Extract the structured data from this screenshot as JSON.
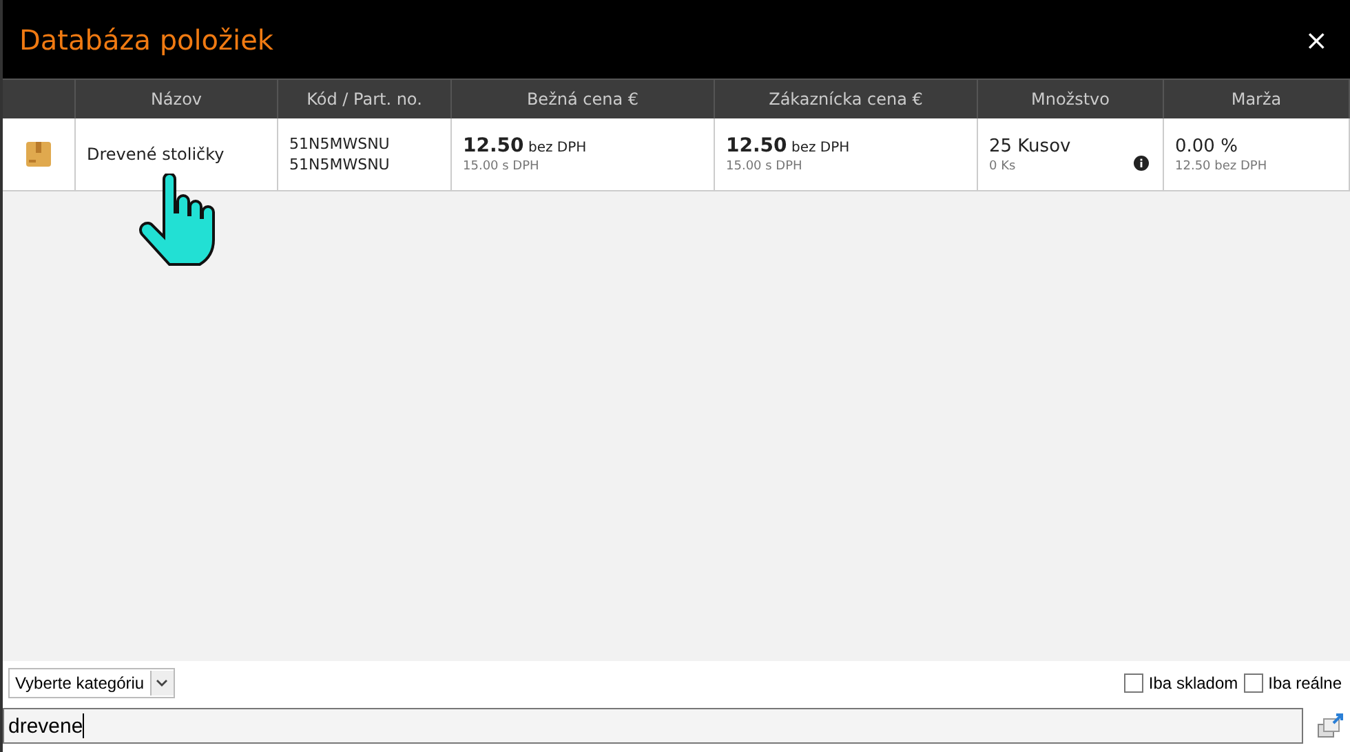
{
  "window": {
    "title": "Databáza položiek",
    "close": "×"
  },
  "table": {
    "columns": [
      "",
      "Názov",
      "Kód / Part. no.",
      "Bežná cena €",
      "Zákaznícka cena €",
      "Množstvo",
      "Marža"
    ],
    "rows": [
      {
        "name": "Drevené stoličky",
        "codes": [
          "51N5MWSNU",
          "51N5MWSNU"
        ],
        "price": {
          "main": "12.50",
          "unit": "bez DPH",
          "sub": "15.00 s DPH"
        },
        "customer_price": {
          "main": "12.50",
          "unit": "bez DPH",
          "sub": "15.00 s DPH"
        },
        "quantity": {
          "main": "25 Kusov",
          "sub": "0 Ks"
        },
        "margin": {
          "main": "0.00 %",
          "sub": "12.50 bez DPH"
        }
      }
    ]
  },
  "category_select": {
    "value": "Vyberte kategóriu"
  },
  "checkboxes": [
    {
      "label": "Iba skladom",
      "checked": false
    },
    {
      "label": "Iba reálne",
      "checked": false
    }
  ],
  "search": {
    "value": "drevene"
  }
}
